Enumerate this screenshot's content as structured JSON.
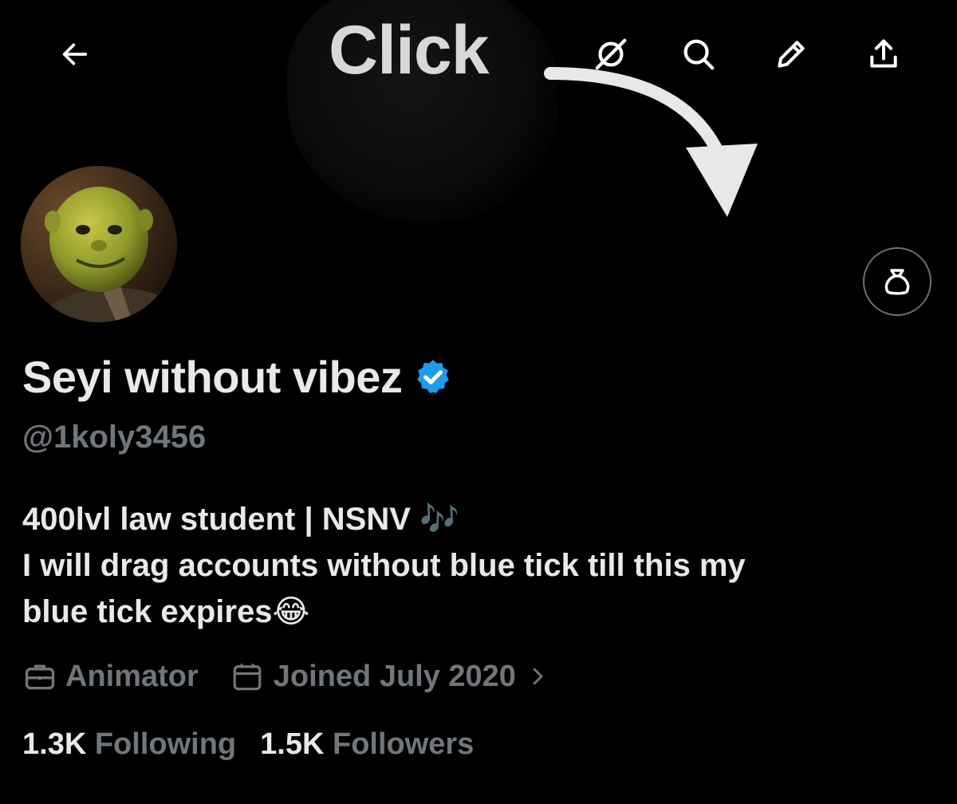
{
  "annotation": {
    "overlay_text": "Click"
  },
  "header_icons": {
    "back": "arrow-left-icon",
    "grok": "grok-icon",
    "search": "search-icon",
    "edit": "pencil-icon",
    "share": "share-icon"
  },
  "profile": {
    "display_name": "Seyi without vibez",
    "verified": true,
    "handle": "@1koly3456",
    "bio_lines": [
      "400lvl law student | NSNV 🎶",
      "I will drag accounts without blue tick till this my",
      "blue tick expires😂"
    ],
    "profession": "Animator",
    "joined": "Joined July 2020",
    "following_count": "1.3K",
    "following_label": "Following",
    "followers_count": "1.5K",
    "followers_label": "Followers"
  },
  "colors": {
    "background": "#000000",
    "primary_text": "#e7e9ea",
    "secondary_text": "#71767b",
    "verified_blue": "#1d9bf0"
  }
}
